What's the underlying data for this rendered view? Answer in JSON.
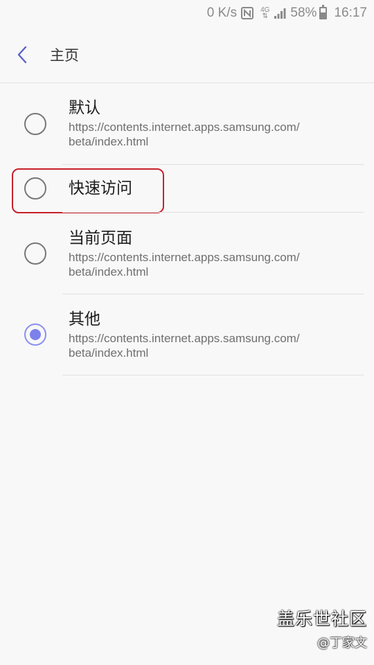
{
  "status_bar": {
    "speed": "0 K/s",
    "nfc_icon": "nfc-icon",
    "network": "4G",
    "battery": "58%",
    "time": "16:17"
  },
  "header": {
    "back_icon": "chevron-left-icon",
    "title": "主页"
  },
  "options": [
    {
      "title": "默认",
      "desc_line1": "https://contents.internet.apps.samsung.com/",
      "desc_line2": "beta/index.html",
      "checked": false
    },
    {
      "title": "快速访问",
      "checked": false
    },
    {
      "title": "当前页面",
      "desc_line1": "https://contents.internet.apps.samsung.com/",
      "desc_line2": "beta/index.html",
      "checked": false
    },
    {
      "title": "其他",
      "desc_line1": "https://contents.internet.apps.samsung.com/",
      "desc_line2": "beta/index.html",
      "checked": true
    }
  ],
  "watermark": {
    "logo": "盖乐世社区",
    "author": "@丁家文"
  },
  "colors": {
    "accent": "#7c81ec",
    "highlight": "#c8202a",
    "back_icon": "#5b62c9"
  }
}
